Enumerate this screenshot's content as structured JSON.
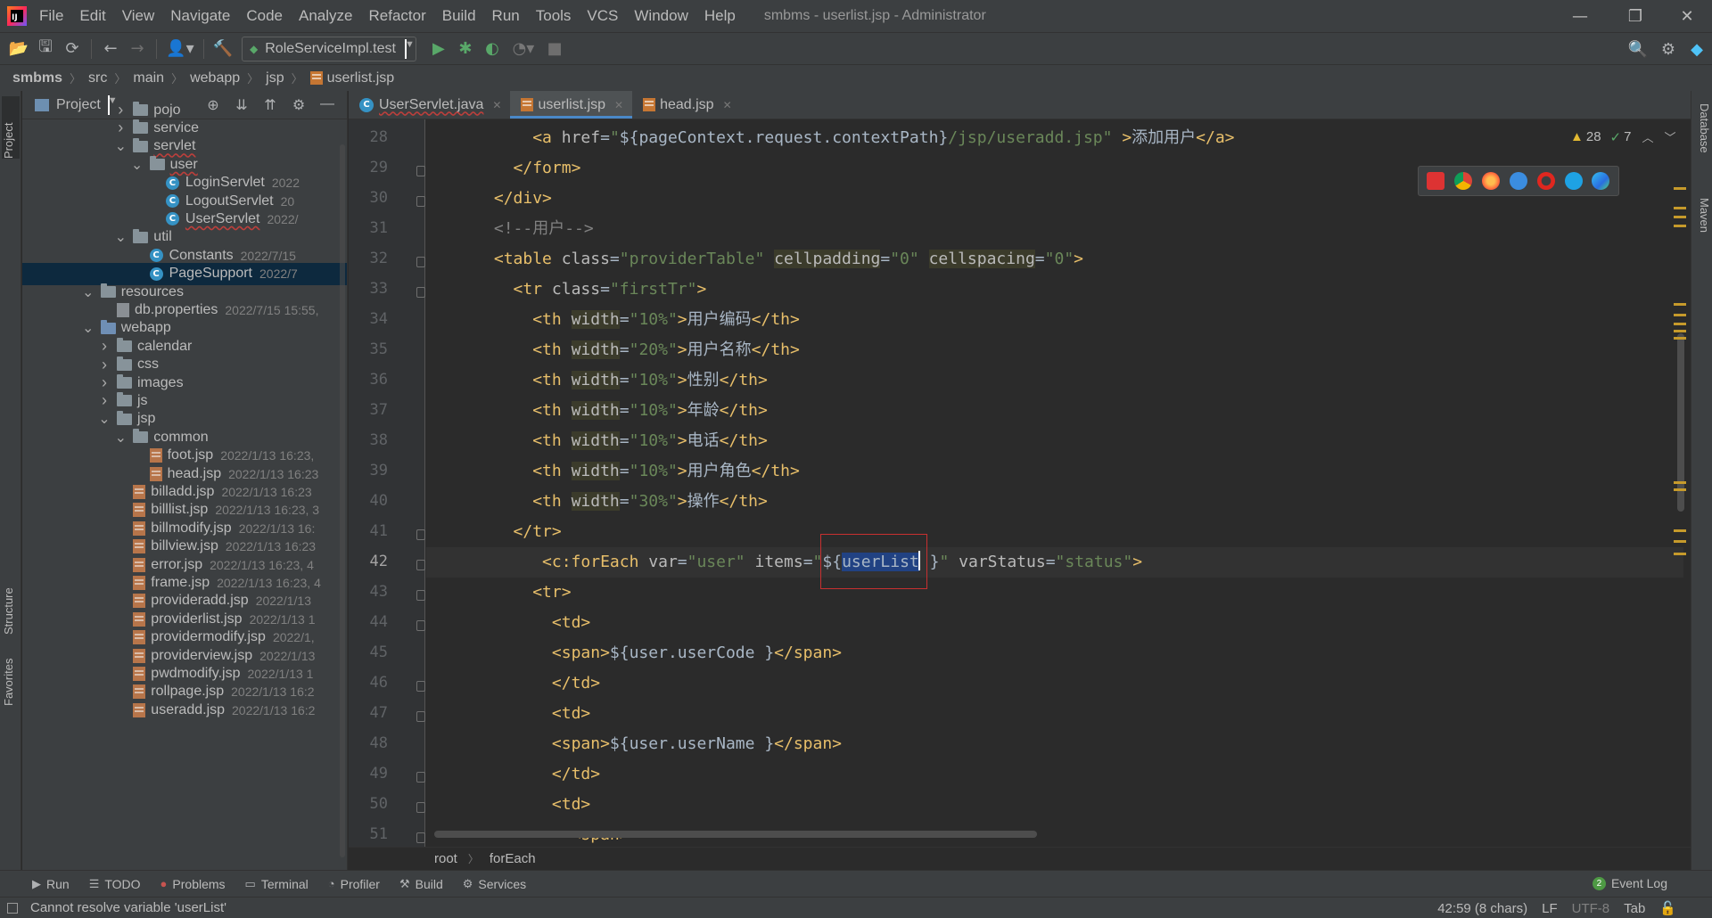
{
  "window": {
    "title": "smbms - userlist.jsp - Administrator",
    "menu": [
      "File",
      "Edit",
      "View",
      "Navigate",
      "Code",
      "Analyze",
      "Refactor",
      "Build",
      "Run",
      "Tools",
      "VCS",
      "Window",
      "Help"
    ]
  },
  "toolbar": {
    "run_config": "RoleServiceImpl.test"
  },
  "breadcrumb": [
    "smbms",
    "src",
    "main",
    "webapp",
    "jsp",
    "userlist.jsp"
  ],
  "left_strip": {
    "project": "Project",
    "structure": "Structure",
    "favorites": "Favorites"
  },
  "right_strip": {
    "database": "Database",
    "maven": "Maven"
  },
  "project_panel": {
    "title": "Project",
    "tree": [
      {
        "label": "pojo",
        "type": "folder",
        "depth": 1,
        "expanded": false
      },
      {
        "label": "service",
        "type": "folder",
        "depth": 1,
        "expanded": false
      },
      {
        "label": "servlet",
        "type": "folder",
        "depth": 1,
        "expanded": true,
        "error": true
      },
      {
        "label": "user",
        "type": "folder",
        "depth": 2,
        "expanded": true,
        "error": true
      },
      {
        "label": "LoginServlet",
        "type": "class",
        "depth": 3,
        "meta": "2022"
      },
      {
        "label": "LogoutServlet",
        "type": "class",
        "depth": 3,
        "meta": "20"
      },
      {
        "label": "UserServlet",
        "type": "class",
        "depth": 3,
        "meta": "2022/",
        "error": true
      },
      {
        "label": "util",
        "type": "folder",
        "depth": 1,
        "expanded": true
      },
      {
        "label": "Constants",
        "type": "class",
        "depth": 2,
        "meta": "2022/7/15"
      },
      {
        "label": "PageSupport",
        "type": "class",
        "depth": 2,
        "meta": "2022/7",
        "selected": true
      },
      {
        "label": "resources",
        "type": "resfolder",
        "depth": -1,
        "expanded": true
      },
      {
        "label": "db.properties",
        "type": "prop",
        "depth": 0,
        "meta": "2022/7/15 15:55,"
      },
      {
        "label": "webapp",
        "type": "webfolder",
        "depth": -1,
        "expanded": true
      },
      {
        "label": "calendar",
        "type": "folder",
        "depth": 0,
        "expanded": false
      },
      {
        "label": "css",
        "type": "folder",
        "depth": 0,
        "expanded": false
      },
      {
        "label": "images",
        "type": "folder",
        "depth": 0,
        "expanded": false
      },
      {
        "label": "js",
        "type": "folder",
        "depth": 0,
        "expanded": false
      },
      {
        "label": "jsp",
        "type": "folder",
        "depth": 0,
        "expanded": true
      },
      {
        "label": "common",
        "type": "folder",
        "depth": 1,
        "expanded": true
      },
      {
        "label": "foot.jsp",
        "type": "jsp",
        "depth": 2,
        "meta": "2022/1/13 16:23,"
      },
      {
        "label": "head.jsp",
        "type": "jsp",
        "depth": 2,
        "meta": "2022/1/13 16:23"
      },
      {
        "label": "billadd.jsp",
        "type": "jsp",
        "depth": 1,
        "meta": "2022/1/13 16:23"
      },
      {
        "label": "billlist.jsp",
        "type": "jsp",
        "depth": 1,
        "meta": "2022/1/13 16:23, 3"
      },
      {
        "label": "billmodify.jsp",
        "type": "jsp",
        "depth": 1,
        "meta": "2022/1/13 16:"
      },
      {
        "label": "billview.jsp",
        "type": "jsp",
        "depth": 1,
        "meta": "2022/1/13 16:23"
      },
      {
        "label": "error.jsp",
        "type": "jsp",
        "depth": 1,
        "meta": "2022/1/13 16:23, 4"
      },
      {
        "label": "frame.jsp",
        "type": "jsp",
        "depth": 1,
        "meta": "2022/1/13 16:23, 4"
      },
      {
        "label": "provideradd.jsp",
        "type": "jsp",
        "depth": 1,
        "meta": "2022/1/13"
      },
      {
        "label": "providerlist.jsp",
        "type": "jsp",
        "depth": 1,
        "meta": "2022/1/13 1"
      },
      {
        "label": "providermodify.jsp",
        "type": "jsp",
        "depth": 1,
        "meta": "2022/1,"
      },
      {
        "label": "providerview.jsp",
        "type": "jsp",
        "depth": 1,
        "meta": "2022/1/13"
      },
      {
        "label": "pwdmodify.jsp",
        "type": "jsp",
        "depth": 1,
        "meta": "2022/1/13 1"
      },
      {
        "label": "rollpage.jsp",
        "type": "jsp",
        "depth": 1,
        "meta": "2022/1/13 16:2"
      },
      {
        "label": "useradd.jsp",
        "type": "jsp",
        "depth": 1,
        "meta": "2022/1/13 16:2"
      }
    ]
  },
  "editor": {
    "tabs": [
      {
        "label": "UserServlet.java",
        "icon": "class-icon",
        "active": false,
        "error": true
      },
      {
        "label": "userlist.jsp",
        "icon": "jsp-icon",
        "active": true
      },
      {
        "label": "head.jsp",
        "icon": "jsp-icon",
        "active": false
      }
    ],
    "inspection": {
      "warnings": "28",
      "ok": "7"
    },
    "caret_line": "42",
    "lines": [
      {
        "no": "28",
        "indent": "        ",
        "tokens": [
          [
            "tag",
            "<a "
          ],
          [
            "attr",
            "href"
          ],
          [
            "txt",
            "="
          ],
          [
            "str",
            "\""
          ],
          [
            "jsp",
            "${pageContext.request.contextPath}"
          ],
          [
            "str",
            "/jsp/useradd.jsp\""
          ],
          [
            "txt",
            " "
          ],
          [
            "tag",
            ">"
          ],
          [
            "txt",
            "添加用户"
          ],
          [
            "tag",
            "</a>"
          ]
        ]
      },
      {
        "no": "29",
        "indent": "      ",
        "tokens": [
          [
            "tag",
            "</form>"
          ]
        ]
      },
      {
        "no": "30",
        "indent": "    ",
        "tokens": [
          [
            "tag",
            "</div>"
          ]
        ]
      },
      {
        "no": "31",
        "indent": "    ",
        "tokens": [
          [
            "cmt",
            "<!--用户-->"
          ]
        ]
      },
      {
        "no": "32",
        "indent": "    ",
        "tokens": [
          [
            "tag",
            "<table "
          ],
          [
            "attr",
            "class"
          ],
          [
            "txt",
            "="
          ],
          [
            "str",
            "\"providerTable\""
          ],
          [
            "txt",
            " "
          ],
          [
            "hl",
            "cellpadding"
          ],
          [
            "txt",
            "="
          ],
          [
            "str",
            "\"0\""
          ],
          [
            "txt",
            " "
          ],
          [
            "hl",
            "cellspacing"
          ],
          [
            "txt",
            "="
          ],
          [
            "str",
            "\"0\""
          ],
          [
            "tag",
            ">"
          ]
        ]
      },
      {
        "no": "33",
        "indent": "      ",
        "tokens": [
          [
            "tag",
            "<tr "
          ],
          [
            "attr",
            "class"
          ],
          [
            "txt",
            "="
          ],
          [
            "str",
            "\"firstTr\""
          ],
          [
            "tag",
            ">"
          ]
        ]
      },
      {
        "no": "34",
        "indent": "        ",
        "tokens": [
          [
            "tag",
            "<th "
          ],
          [
            "hl",
            "width"
          ],
          [
            "txt",
            "="
          ],
          [
            "str",
            "\"10%\""
          ],
          [
            "tag",
            ">"
          ],
          [
            "txt",
            "用户编码"
          ],
          [
            "tag",
            "</th>"
          ]
        ]
      },
      {
        "no": "35",
        "indent": "        ",
        "tokens": [
          [
            "tag",
            "<th "
          ],
          [
            "hl",
            "width"
          ],
          [
            "txt",
            "="
          ],
          [
            "str",
            "\"20%\""
          ],
          [
            "tag",
            ">"
          ],
          [
            "txt",
            "用户名称"
          ],
          [
            "tag",
            "</th>"
          ]
        ]
      },
      {
        "no": "36",
        "indent": "        ",
        "tokens": [
          [
            "tag",
            "<th "
          ],
          [
            "hl",
            "width"
          ],
          [
            "txt",
            "="
          ],
          [
            "str",
            "\"10%\""
          ],
          [
            "tag",
            ">"
          ],
          [
            "txt",
            "性别"
          ],
          [
            "tag",
            "</th>"
          ]
        ]
      },
      {
        "no": "37",
        "indent": "        ",
        "tokens": [
          [
            "tag",
            "<th "
          ],
          [
            "hl",
            "width"
          ],
          [
            "txt",
            "="
          ],
          [
            "str",
            "\"10%\""
          ],
          [
            "tag",
            ">"
          ],
          [
            "txt",
            "年龄"
          ],
          [
            "tag",
            "</th>"
          ]
        ]
      },
      {
        "no": "38",
        "indent": "        ",
        "tokens": [
          [
            "tag",
            "<th "
          ],
          [
            "hl",
            "width"
          ],
          [
            "txt",
            "="
          ],
          [
            "str",
            "\"10%\""
          ],
          [
            "tag",
            ">"
          ],
          [
            "txt",
            "电话"
          ],
          [
            "tag",
            "</th>"
          ]
        ]
      },
      {
        "no": "39",
        "indent": "        ",
        "tokens": [
          [
            "tag",
            "<th "
          ],
          [
            "hl",
            "width"
          ],
          [
            "txt",
            "="
          ],
          [
            "str",
            "\"10%\""
          ],
          [
            "tag",
            ">"
          ],
          [
            "txt",
            "用户角色"
          ],
          [
            "tag",
            "</th>"
          ]
        ]
      },
      {
        "no": "40",
        "indent": "        ",
        "tokens": [
          [
            "tag",
            "<th "
          ],
          [
            "hl",
            "width"
          ],
          [
            "txt",
            "="
          ],
          [
            "str",
            "\"30%\""
          ],
          [
            "tag",
            ">"
          ],
          [
            "txt",
            "操作"
          ],
          [
            "tag",
            "</th>"
          ]
        ]
      },
      {
        "no": "41",
        "indent": "      ",
        "tokens": [
          [
            "tag",
            "</tr>"
          ]
        ]
      },
      {
        "no": "42",
        "indent": "         ",
        "tokens": [
          [
            "tag",
            "<c:forEach "
          ],
          [
            "attr",
            "var"
          ],
          [
            "txt",
            "="
          ],
          [
            "str",
            "\"user\""
          ],
          [
            "txt",
            " "
          ],
          [
            "attr",
            "items"
          ],
          [
            "txt",
            "="
          ],
          [
            "str",
            "\""
          ],
          [
            "jsp",
            "${"
          ],
          [
            "sel",
            "userList"
          ],
          [
            "caret",
            ""
          ],
          [
            "jsp",
            " }"
          ],
          [
            "str",
            "\""
          ],
          [
            "txt",
            " "
          ],
          [
            "attr",
            "varStatus"
          ],
          [
            "txt",
            "="
          ],
          [
            "str",
            "\"status\""
          ],
          [
            "tag",
            ">"
          ]
        ]
      },
      {
        "no": "43",
        "indent": "        ",
        "tokens": [
          [
            "tag",
            "<tr>"
          ]
        ]
      },
      {
        "no": "44",
        "indent": "          ",
        "tokens": [
          [
            "tag",
            "<td>"
          ]
        ]
      },
      {
        "no": "45",
        "indent": "          ",
        "tokens": [
          [
            "tag",
            "<span>"
          ],
          [
            "jsp",
            "${user.userCode }"
          ],
          [
            "tag",
            "</span>"
          ]
        ]
      },
      {
        "no": "46",
        "indent": "          ",
        "tokens": [
          [
            "tag",
            "</td>"
          ]
        ]
      },
      {
        "no": "47",
        "indent": "          ",
        "tokens": [
          [
            "tag",
            "<td>"
          ]
        ]
      },
      {
        "no": "48",
        "indent": "          ",
        "tokens": [
          [
            "tag",
            "<span>"
          ],
          [
            "jsp",
            "${user.userName }"
          ],
          [
            "tag",
            "</span>"
          ]
        ]
      },
      {
        "no": "49",
        "indent": "          ",
        "tokens": [
          [
            "tag",
            "</td>"
          ]
        ]
      },
      {
        "no": "50",
        "indent": "          ",
        "tokens": [
          [
            "tag",
            "<td>"
          ]
        ]
      },
      {
        "no": "51",
        "indent": "            ",
        "tokens": [
          [
            "tag",
            "<span>"
          ]
        ]
      }
    ]
  },
  "code_crumbs": [
    "root",
    "forEach"
  ],
  "bottom_tools": [
    "Run",
    "TODO",
    "Problems",
    "Terminal",
    "Profiler",
    "Build",
    "Services"
  ],
  "event_log": {
    "count": "2",
    "label": "Event Log"
  },
  "status": {
    "message": "Cannot resolve variable 'userList'",
    "position": "42:59 (8 chars)",
    "line_sep": "LF",
    "encoding": "UTF-8",
    "indent": "Tab"
  },
  "colors": {
    "accent": "#4a88c7",
    "error": "#c83030",
    "selection": "#214283"
  }
}
